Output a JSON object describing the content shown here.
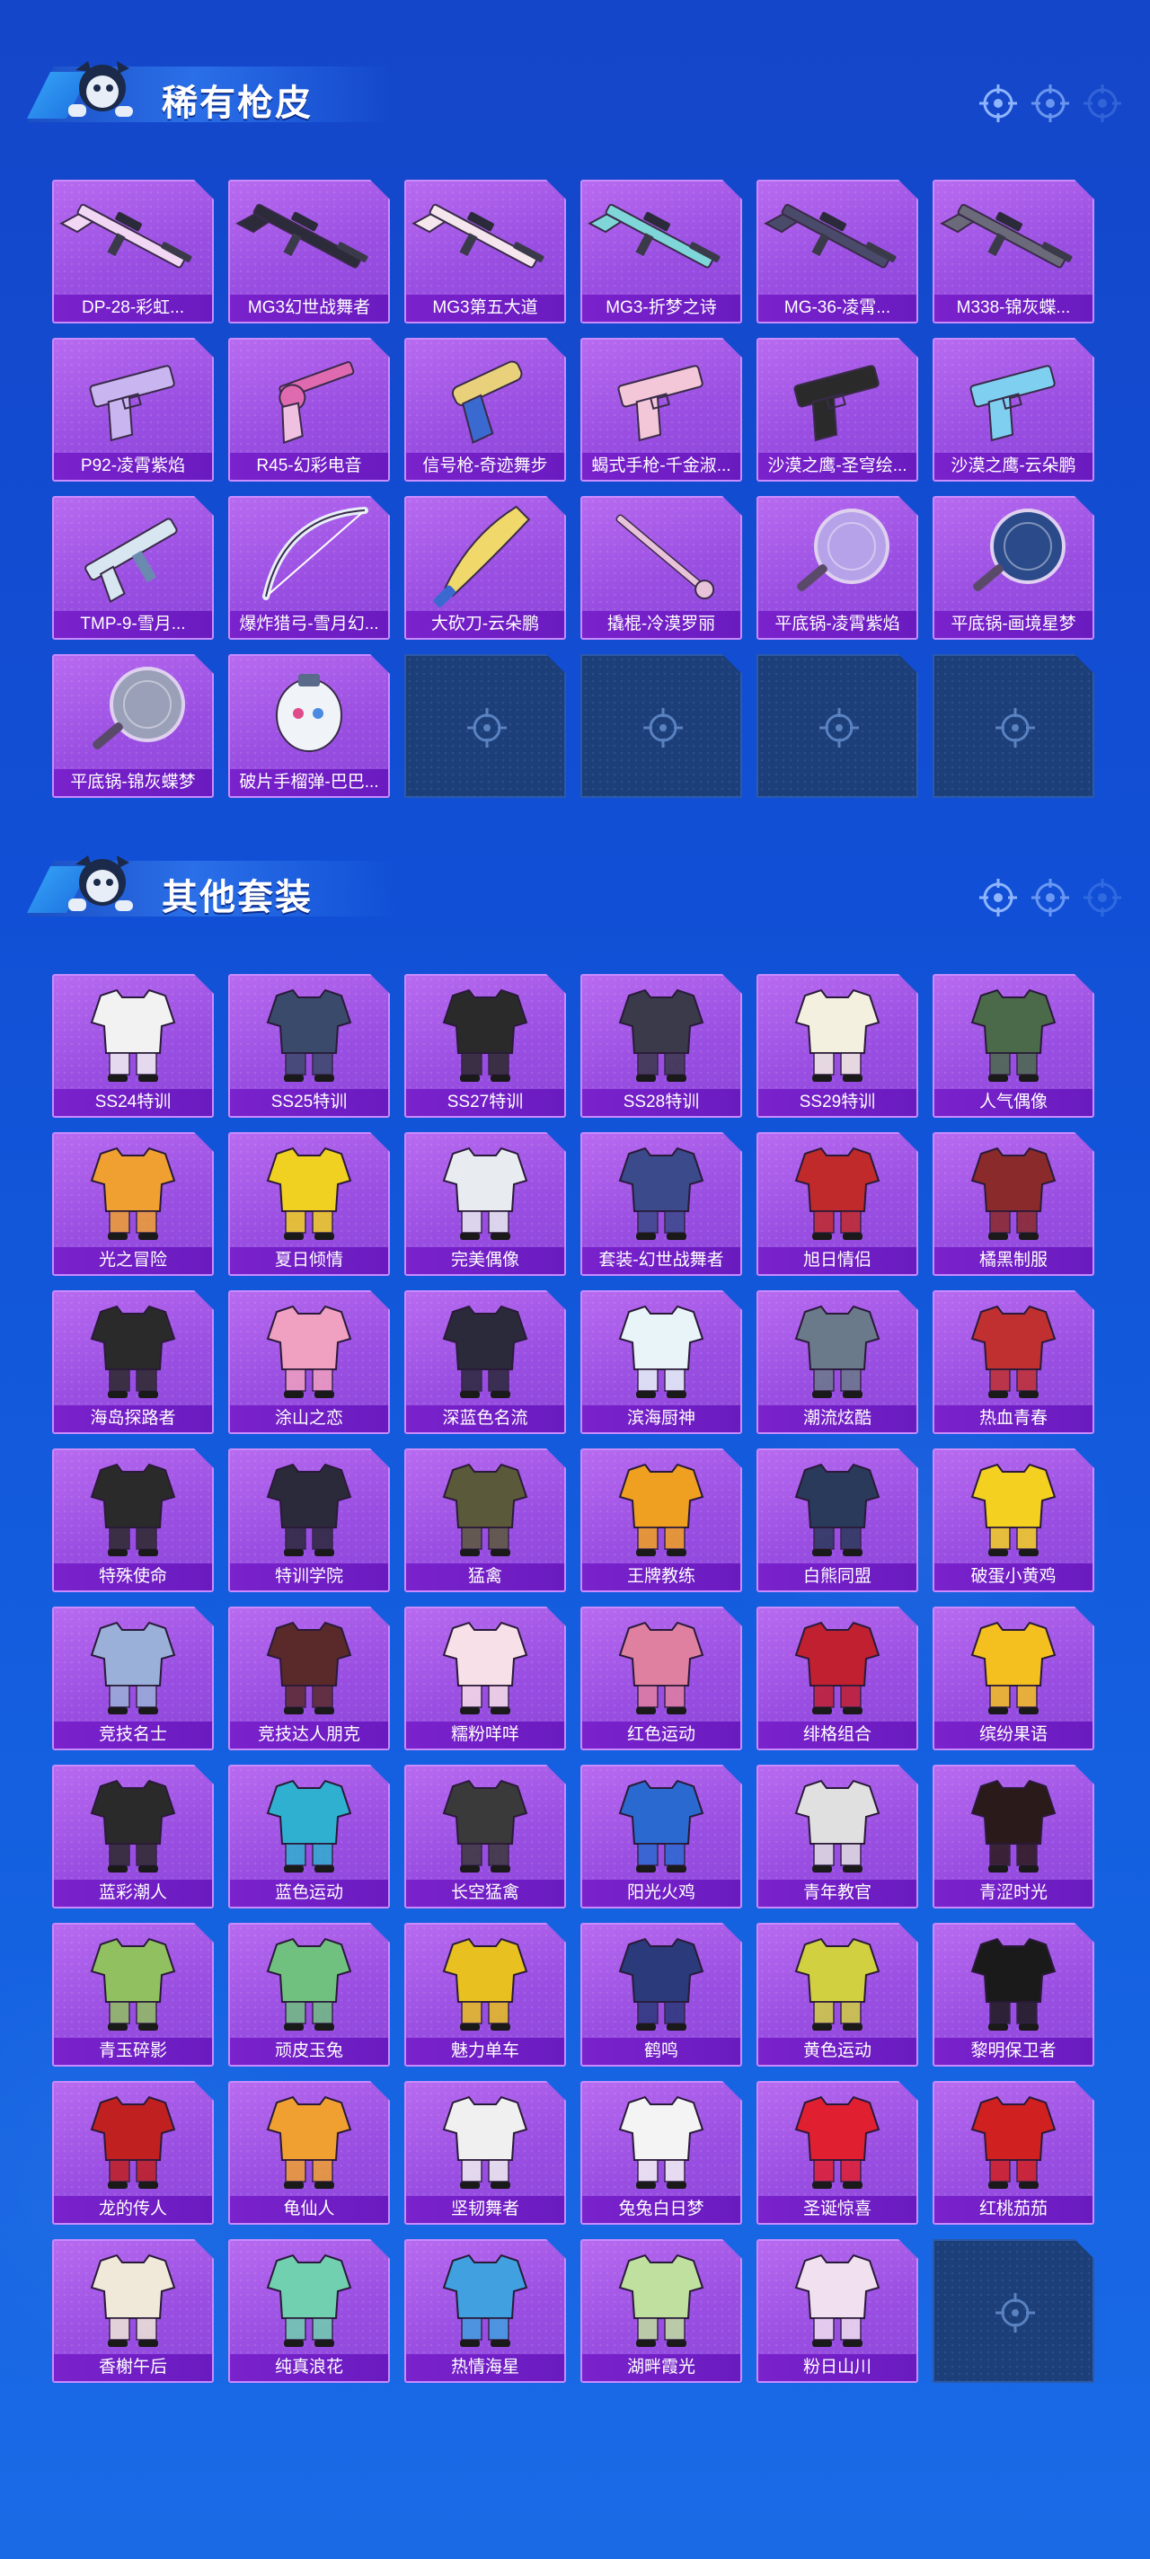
{
  "sections": [
    {
      "title": "稀有枪皮",
      "items": [
        {
          "label": "DP-28-彩虹...",
          "icon": "rifle-icon",
          "color": "#f2d7f5"
        },
        {
          "label": "MG3幻世战舞者",
          "icon": "rifle-icon",
          "color": "#2b2b3a"
        },
        {
          "label": "MG3第五大道",
          "icon": "rifle-icon",
          "color": "#f5e6ee"
        },
        {
          "label": "MG3-折梦之诗",
          "icon": "rifle-icon",
          "color": "#7fd6d8"
        },
        {
          "label": "MG-36-凌霄...",
          "icon": "rifle-icon",
          "color": "#4a4a6a"
        },
        {
          "label": "M338-锦灰蝶...",
          "icon": "rifle-icon",
          "color": "#6a6a7a"
        },
        {
          "label": "P92-凌霄紫焰",
          "icon": "pistol-icon",
          "color": "#c9b6f0"
        },
        {
          "label": "R45-幻彩电音",
          "icon": "revolver-icon",
          "color": "#e06ab0"
        },
        {
          "label": "信号枪-奇迹舞步",
          "icon": "flare-gun-icon",
          "color": "#e8d17a"
        },
        {
          "label": "蝎式手枪-千金淑...",
          "icon": "pistol-icon",
          "color": "#f3c6d8"
        },
        {
          "label": "沙漠之鹰-圣穹绘...",
          "icon": "pistol-icon",
          "color": "#2a2a2a"
        },
        {
          "label": "沙漠之鹰-云朵鹏",
          "icon": "pistol-icon",
          "color": "#7fd0f0"
        },
        {
          "label": "TMP-9-雪月...",
          "icon": "smg-icon",
          "color": "#d8e6f2"
        },
        {
          "label": "爆炸猎弓-雪月幻...",
          "icon": "bow-icon",
          "color": "#e6eef8"
        },
        {
          "label": "大砍刀-云朵鹏",
          "icon": "machete-icon",
          "color": "#f0d86a"
        },
        {
          "label": "撬棍-冷漠罗丽",
          "icon": "crowbar-icon",
          "color": "#e8c2d8"
        },
        {
          "label": "平底锅-凌霄紫焰",
          "icon": "pan-icon",
          "color": "#b6a2e8"
        },
        {
          "label": "平底锅-画境星梦",
          "icon": "pan-icon",
          "color": "#2a4a8a"
        },
        {
          "label": "平底锅-锦灰蝶梦",
          "icon": "pan-icon",
          "color": "#9aa0b8"
        },
        {
          "label": "破片手榴弹-巴巴...",
          "icon": "grenade-icon",
          "color": "#f0f4f8"
        }
      ],
      "empty_slots": 4
    },
    {
      "title": "其他套装",
      "items": [
        {
          "label": "SS24特训",
          "icon": "outfit-icon",
          "color": "#f2f2f2"
        },
        {
          "label": "SS25特训",
          "icon": "outfit-icon",
          "color": "#3a4a6a"
        },
        {
          "label": "SS27特训",
          "icon": "outfit-icon",
          "color": "#2a2a2a"
        },
        {
          "label": "SS28特训",
          "icon": "outfit-icon",
          "color": "#3a3a4a"
        },
        {
          "label": "SS29特训",
          "icon": "outfit-icon",
          "color": "#f4f0e0"
        },
        {
          "label": "人气偶像",
          "icon": "outfit-icon",
          "color": "#4a6a4a"
        },
        {
          "label": "光之冒险",
          "icon": "outfit-icon",
          "color": "#f0a030"
        },
        {
          "label": "夏日倾情",
          "icon": "outfit-icon",
          "color": "#f0d020"
        },
        {
          "label": "完美偶像",
          "icon": "outfit-icon",
          "color": "#e8ecf0"
        },
        {
          "label": "套装-幻世战舞者",
          "icon": "outfit-icon",
          "color": "#3a4a8a"
        },
        {
          "label": "旭日情侣",
          "icon": "outfit-icon",
          "color": "#c02a2a"
        },
        {
          "label": "橘黑制服",
          "icon": "outfit-icon",
          "color": "#8a2a2a"
        },
        {
          "label": "海岛探路者",
          "icon": "outfit-icon",
          "color": "#2a2a2a"
        },
        {
          "label": "涂山之恋",
          "icon": "outfit-icon",
          "color": "#f0a0c0"
        },
        {
          "label": "深蓝色名流",
          "icon": "outfit-icon",
          "color": "#2a2a3a"
        },
        {
          "label": "滨海厨神",
          "icon": "outfit-icon",
          "color": "#e8f4f8"
        },
        {
          "label": "潮流炫酷",
          "icon": "outfit-icon",
          "color": "#6a7a8a"
        },
        {
          "label": "热血青春",
          "icon": "outfit-icon",
          "color": "#c03030"
        },
        {
          "label": "特殊使命",
          "icon": "outfit-icon",
          "color": "#2a2a2a"
        },
        {
          "label": "特训学院",
          "icon": "outfit-icon",
          "color": "#2a2a3a"
        },
        {
          "label": "猛禽",
          "icon": "outfit-icon",
          "color": "#5a5a3a"
        },
        {
          "label": "王牌教练",
          "icon": "outfit-icon",
          "color": "#f0a020"
        },
        {
          "label": "白熊同盟",
          "icon": "outfit-icon",
          "color": "#2a3a5a"
        },
        {
          "label": "破蛋小黄鸡",
          "icon": "outfit-icon",
          "color": "#f4d020"
        },
        {
          "label": "竞技名士",
          "icon": "outfit-icon",
          "color": "#9ab0d8"
        },
        {
          "label": "竞技达人朋克",
          "icon": "outfit-icon",
          "color": "#5a2a2a"
        },
        {
          "label": "糯粉咩咩",
          "icon": "outfit-icon",
          "color": "#f8e0e8"
        },
        {
          "label": "红色运动",
          "icon": "outfit-icon",
          "color": "#e080a0"
        },
        {
          "label": "绯格组合",
          "icon": "outfit-icon",
          "color": "#c02030"
        },
        {
          "label": "缤纷果语",
          "icon": "outfit-icon",
          "color": "#f4c020"
        },
        {
          "label": "蓝彩潮人",
          "icon": "outfit-icon",
          "color": "#2a2a2a"
        },
        {
          "label": "蓝色运动",
          "icon": "outfit-icon",
          "color": "#30b0d0"
        },
        {
          "label": "长空猛禽",
          "icon": "outfit-icon",
          "color": "#3a3a3a"
        },
        {
          "label": "阳光火鸡",
          "icon": "outfit-icon",
          "color": "#2a6ad0"
        },
        {
          "label": "青年教官",
          "icon": "outfit-icon",
          "color": "#e0e0e0"
        },
        {
          "label": "青涩时光",
          "icon": "outfit-icon",
          "color": "#2a1a1a"
        },
        {
          "label": "青玉碎影",
          "icon": "outfit-icon",
          "color": "#90c060"
        },
        {
          "label": "顽皮玉兔",
          "icon": "outfit-icon",
          "color": "#70c080"
        },
        {
          "label": "魅力单车",
          "icon": "outfit-icon",
          "color": "#e8c020"
        },
        {
          "label": "鹤鸣",
          "icon": "outfit-icon",
          "color": "#2a3a7a"
        },
        {
          "label": "黄色运动",
          "icon": "outfit-icon",
          "color": "#d0d040"
        },
        {
          "label": "黎明保卫者",
          "icon": "outfit-icon",
          "color": "#1a1a1a"
        },
        {
          "label": "龙的传人",
          "icon": "outfit-icon",
          "color": "#c02020"
        },
        {
          "label": "龟仙人",
          "icon": "outfit-icon",
          "color": "#f0a030"
        },
        {
          "label": "坚韧舞者",
          "icon": "outfit-icon",
          "color": "#f0f0f0"
        },
        {
          "label": "兔兔白日梦",
          "icon": "outfit-icon",
          "color": "#f4f4f4"
        },
        {
          "label": "圣诞惊喜",
          "icon": "outfit-icon",
          "color": "#e02030"
        },
        {
          "label": "红桃茄茄",
          "icon": "outfit-icon",
          "color": "#d02020"
        },
        {
          "label": "香榭午后",
          "icon": "outfit-icon",
          "color": "#f0e8d8"
        },
        {
          "label": "纯真浪花",
          "icon": "outfit-icon",
          "color": "#70d0b0"
        },
        {
          "label": "热情海星",
          "icon": "outfit-icon",
          "color": "#40a0e0"
        },
        {
          "label": "湖畔霞光",
          "icon": "outfit-icon",
          "color": "#c0e0a0"
        },
        {
          "label": "粉日山川",
          "icon": "outfit-icon",
          "color": "#f0e0f0"
        }
      ],
      "empty_slots": 1
    }
  ]
}
